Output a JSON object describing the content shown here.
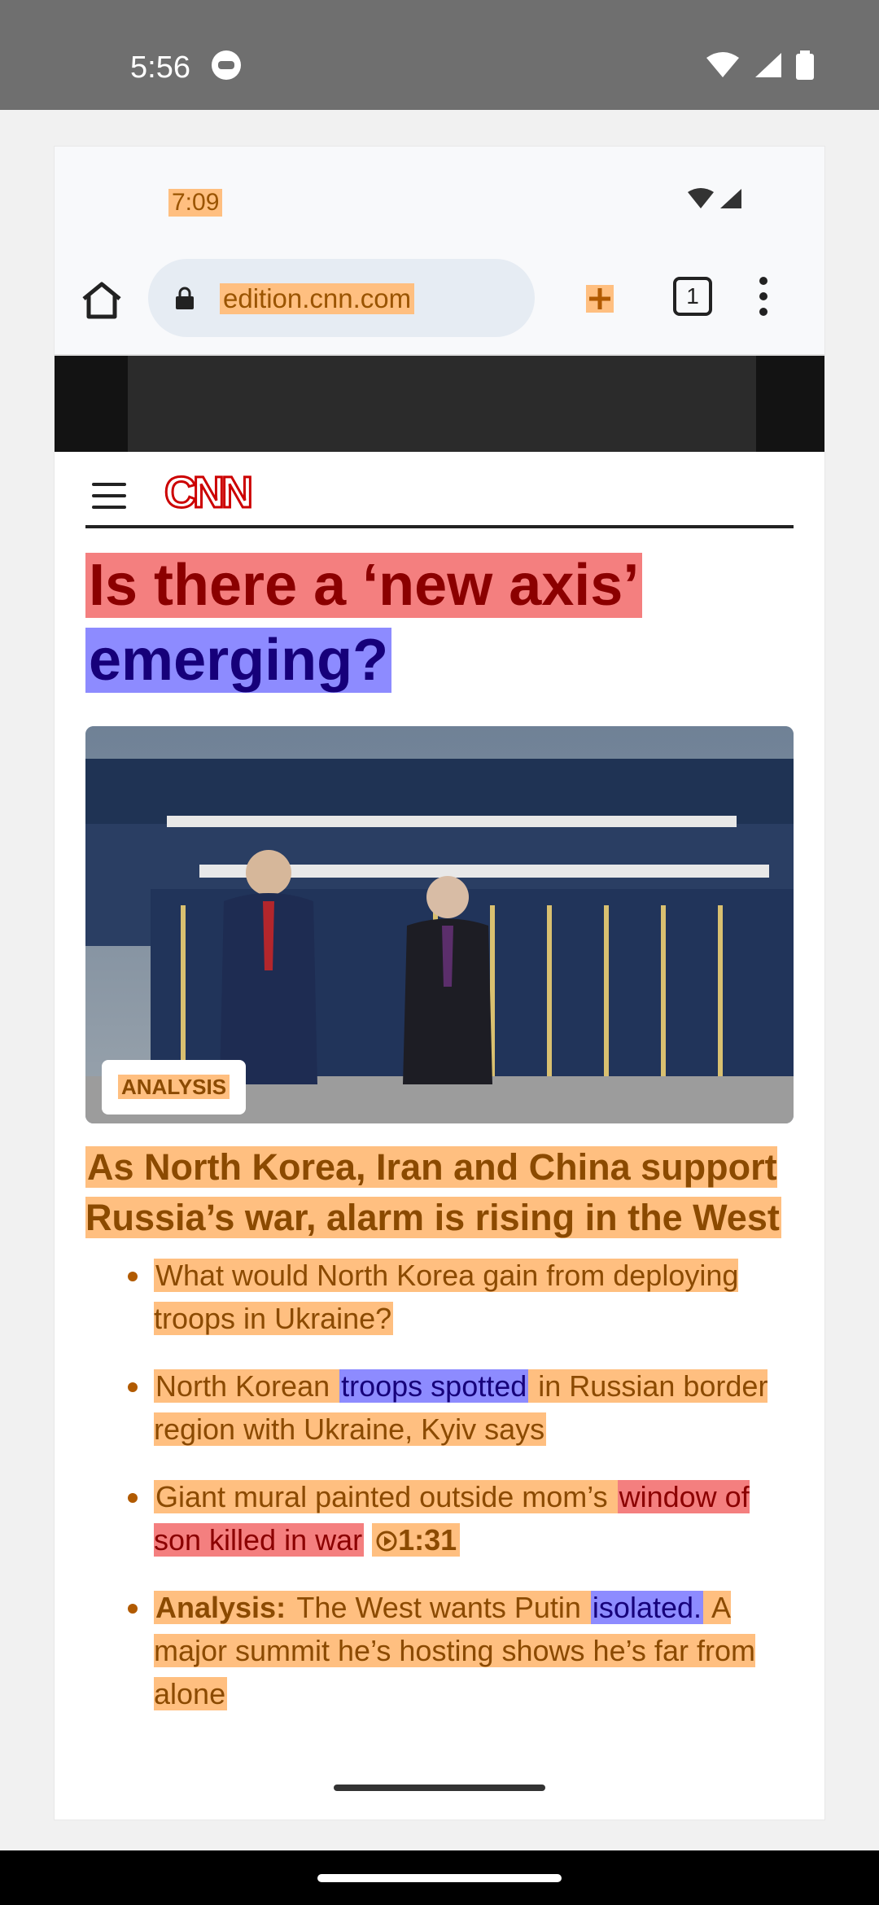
{
  "os_status": {
    "time": "5:56"
  },
  "inner_status": {
    "time": "7:09"
  },
  "browser": {
    "url": "edition.cnn.com",
    "tab_count": "1"
  },
  "article": {
    "headline_part1": "Is there a ‘new axis’",
    "headline_part2": "emerging?",
    "badge": "ANALYSIS",
    "subhead": "As North Korea, Iran and China support Russia’s war, alarm is rising in the West",
    "bullets": [
      {
        "text": "What would North Korea gain from deploying troops in Ukraine?"
      },
      {
        "text_a": "North Korean ",
        "text_b": "troops spotted",
        "text_c": " in Russian border region with Ukraine, Kyiv says"
      },
      {
        "text_a": "Giant mural painted outside mom’s ",
        "text_b": "window of son killed in war",
        "video": "1:31"
      },
      {
        "label": "Analysis:",
        "text_a": " The West wants Putin ",
        "text_b": "isolated.",
        "text_c": " A major summit he’s hosting shows he’s far from alone"
      }
    ]
  }
}
